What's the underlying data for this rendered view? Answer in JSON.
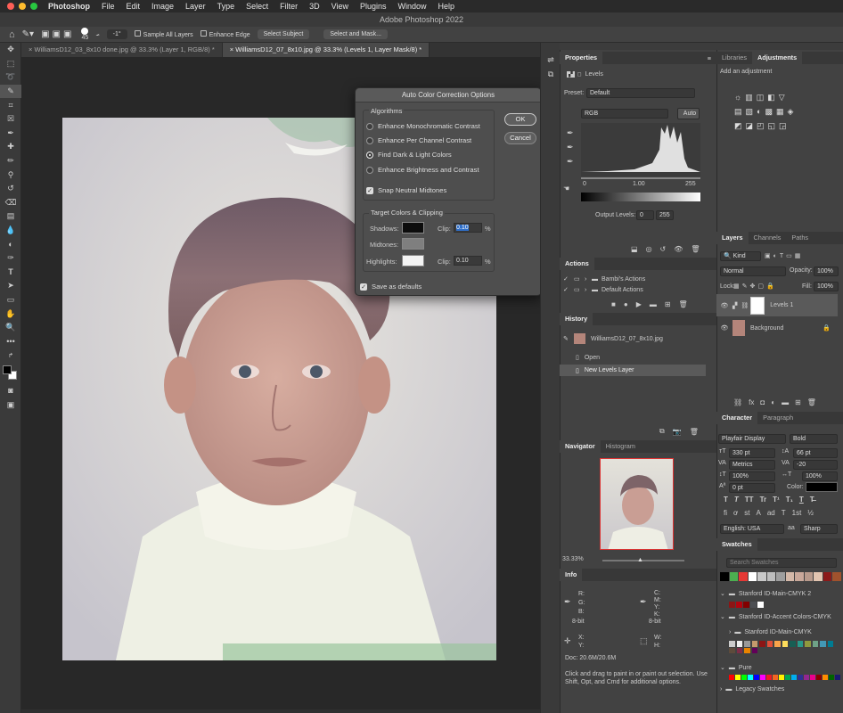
{
  "menubar": {
    "app": "Photoshop",
    "items": [
      "File",
      "Edit",
      "Image",
      "Layer",
      "Type",
      "Select",
      "Filter",
      "3D",
      "View",
      "Plugins",
      "Window",
      "Help"
    ]
  },
  "window": {
    "title": "Adobe Photoshop 2022"
  },
  "options": {
    "brush_size": "45",
    "angle": "-1°",
    "sample_all": "Sample All Layers",
    "enhance_edge": "Enhance Edge",
    "select_subject": "Select Subject",
    "select_mask": "Select and Mask..."
  },
  "doc_tabs": [
    "WilliamsD12_03_8x10 done.jpg @ 33.3% (Layer 1, RGB/8) *",
    "WilliamsD12_07_8x10.jpg @ 33.3% (Levels 1, Layer Mask/8) *"
  ],
  "dialog": {
    "title": "Auto Color Correction Options",
    "algorithms_label": "Algorithms",
    "options": [
      "Enhance Monochromatic Contrast",
      "Enhance Per Channel Contrast",
      "Find Dark & Light Colors",
      "Enhance Brightness and Contrast"
    ],
    "selected_index": 2,
    "snap_label": "Snap Neutral Midtones",
    "ok": "OK",
    "cancel": "Cancel",
    "targets_label": "Target Colors & Clipping",
    "shadows": "Shadows:",
    "midtones": "Midtones:",
    "highlights": "Highlights:",
    "clip": "Clip:",
    "shadow_clip": "0.10",
    "highlight_clip": "0.10",
    "pct": "%",
    "shadow_color": "#0c0c0c",
    "midtone_color": "#7f7f7f",
    "highlight_color": "#f4f4f4",
    "save_defaults": "Save as defaults"
  },
  "properties": {
    "tab": "Properties",
    "levels": "Levels",
    "preset_label": "Preset:",
    "preset": "Default",
    "channel": "RGB",
    "auto": "Auto",
    "in_black": "0",
    "in_mid": "1.00",
    "in_white": "255",
    "output_label": "Output Levels:",
    "out_black": "0",
    "out_white": "255"
  },
  "libraries": {
    "tabs": [
      "Libraries",
      "Adjustments"
    ],
    "add": "Add an adjustment"
  },
  "layers": {
    "tabs": [
      "Layers",
      "Channels",
      "Paths"
    ],
    "kind": "Kind",
    "blend": "Normal",
    "opacity_label": "Opacity:",
    "opacity": "100%",
    "lock_label": "Lock:",
    "fill_label": "Fill:",
    "fill": "100%",
    "items": [
      {
        "name": "Levels 1"
      },
      {
        "name": "Background"
      }
    ]
  },
  "actions": {
    "tab": "Actions",
    "items": [
      "Bambi's Actions",
      "Default Actions"
    ]
  },
  "history": {
    "tab": "History",
    "snapshot": "WilliamsD12_07_8x10.jpg",
    "items": [
      "Open",
      "New Levels Layer"
    ]
  },
  "navigator": {
    "tabs": [
      "Navigator",
      "Histogram"
    ],
    "zoom": "33.33%"
  },
  "info": {
    "tab": "Info",
    "rgb": [
      "R:",
      "G:",
      "B:"
    ],
    "cmyk": [
      "C:",
      "M:",
      "Y:",
      "K:"
    ],
    "bit1": "8-bit",
    "bit2": "8-bit",
    "xy": [
      "X:",
      "Y:"
    ],
    "wh": [
      "W:",
      "H:"
    ],
    "doc": "Doc: 20.6M/20.6M",
    "hint": "Click and drag to paint in or paint out selection.  Use Shift, Opt, and Cmd for additional options."
  },
  "character": {
    "tabs": [
      "Character",
      "Paragraph"
    ],
    "font": "Playfair Display",
    "style": "Bold",
    "size": "330 pt",
    "leading": "66 pt",
    "kerning": "Metrics",
    "tracking": "-20",
    "vscale": "100%",
    "hscale": "100%",
    "baseline": "0 pt",
    "color_label": "Color:",
    "lang": "English: USA",
    "aa": "Sharp",
    "buttons": [
      "T",
      "T",
      "TT",
      "Tr",
      "T¹",
      "T₁",
      "T",
      "T̶"
    ],
    "buttons2": [
      "fi",
      "ơ",
      "st",
      "A",
      "ad",
      "T",
      "1st",
      "½"
    ]
  },
  "swatches": {
    "tab": "Swatches",
    "search": "Search Swatches",
    "groups": [
      "Stanford ID-Main-CMYK 2",
      "Stanford ID-Accent Colors-CMYK",
      "Stanford ID-Main-CMYK",
      "Pure",
      "Legacy Swatches"
    ],
    "top_colors": [
      "#000000",
      "#4caf50",
      "#e53935",
      "#ffffff",
      "#c8c8c8",
      "#bdbdbd",
      "#9e9e9e",
      "#d4b8a8",
      "#c9a89a",
      "#b89a8c",
      "#e2c4b0",
      "#8b1a1a",
      "#a0522d"
    ],
    "group1_colors": [
      "#8c1515",
      "#b1040e",
      "#820000",
      "#4d4f53",
      "#ffffff"
    ],
    "accent_colors": [
      "#ccc",
      "#eee",
      "#999",
      "#c49a6c",
      "#8c1515",
      "#e04f39",
      "#f9a44a",
      "#fedd5c",
      "#175e54",
      "#279989",
      "#8f993e",
      "#6fa287",
      "#4298b5",
      "#007c92",
      "#5d4b3c",
      "#7f2d48",
      "#e98300",
      "#620059"
    ],
    "pure_colors": [
      "#ff0000",
      "#ffff00",
      "#00ff00",
      "#00ffff",
      "#0000ff",
      "#ff00ff",
      "#ed1c24",
      "#f26522",
      "#fff200",
      "#00a651",
      "#00aeef",
      "#2e3192",
      "#92278f",
      "#ec008c",
      "#8b0000",
      "#ff8c00",
      "#006400",
      "#191970"
    ]
  },
  "status": {
    "zoom": "33.33%",
    "doc": "Doc: 20.6M/20.6M"
  }
}
